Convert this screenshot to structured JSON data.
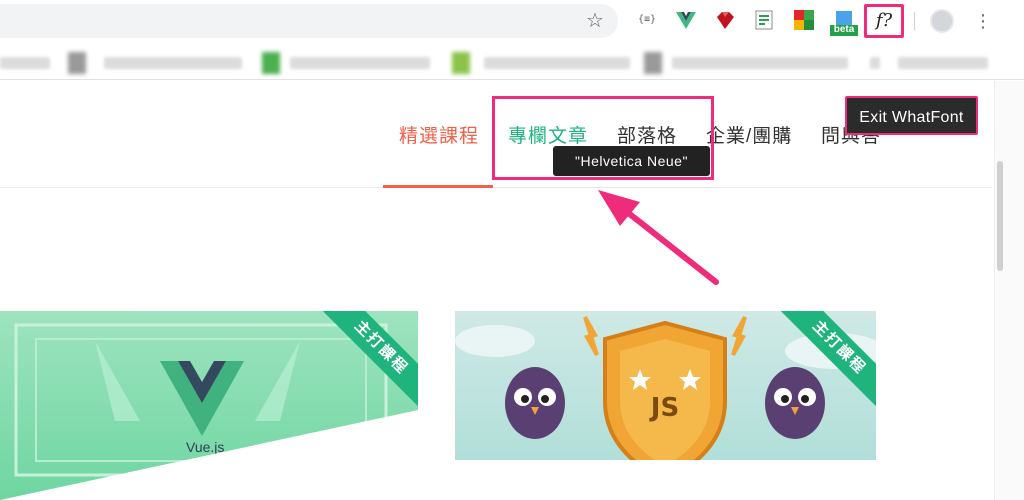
{
  "browser": {
    "extensions": {
      "json_label": "{≡}",
      "beta_label": "beta",
      "whatfont_label": "f?"
    }
  },
  "site": {
    "nav": [
      "精選課程",
      "專欄文章",
      "部落格",
      "企業/團購",
      "問與答"
    ]
  },
  "whatfont": {
    "tooltip": "\"Helvetica Neue\"",
    "exit_label": "Exit WhatFont"
  },
  "cards": [
    {
      "ribbon": "主打課程",
      "logo_text": "Vue.js"
    },
    {
      "ribbon": "主打課程"
    }
  ],
  "colors": {
    "accent_red": "#f0614b",
    "accent_green": "#1fb37e",
    "highlight_pink": "#ef2b7c",
    "tooltip_bg": "#222222"
  }
}
